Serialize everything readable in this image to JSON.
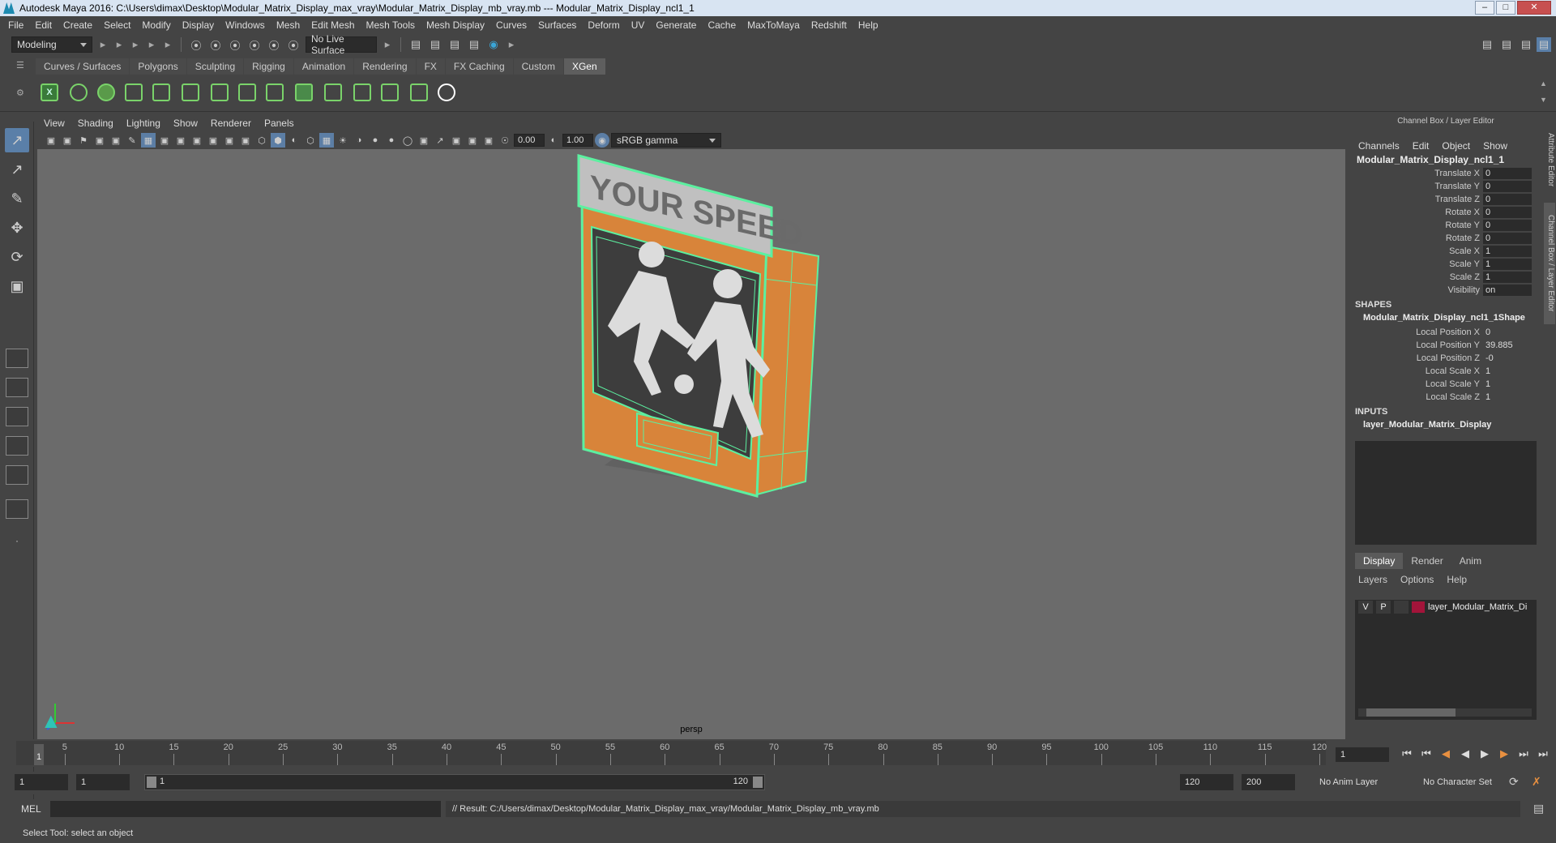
{
  "window": {
    "title": "Autodesk Maya 2016: C:\\Users\\dimax\\Desktop\\Modular_Matrix_Display_max_vray\\Modular_Matrix_Display_mb_vray.mb   ---   Modular_Matrix_Display_ncl1_1",
    "minimize": "–",
    "maximize": "□",
    "close": "✕"
  },
  "menubar": [
    "File",
    "Edit",
    "Create",
    "Select",
    "Modify",
    "Display",
    "Windows",
    "Mesh",
    "Edit Mesh",
    "Mesh Tools",
    "Mesh Display",
    "Curves",
    "Surfaces",
    "Deform",
    "UV",
    "Generate",
    "Cache",
    "MaxToMaya",
    "Redshift",
    "Help"
  ],
  "statusline": {
    "mode": "Modeling",
    "live_surface": "No Live Surface"
  },
  "shelf": {
    "tabs": [
      "Curves / Surfaces",
      "Polygons",
      "Sculpting",
      "Rigging",
      "Animation",
      "Rendering",
      "FX",
      "FX Caching",
      "Custom",
      "XGen"
    ],
    "active_tab": "XGen"
  },
  "viewport": {
    "menu": [
      "View",
      "Shading",
      "Lighting",
      "Show",
      "Renderer",
      "Panels"
    ],
    "exposure": "0.00",
    "gamma": "1.00",
    "color_space": "sRGB gamma",
    "camera_label": "persp",
    "sign_text": "YOUR SPEED"
  },
  "channel_box": {
    "title": "Channel Box / Layer Editor",
    "menu": [
      "Channels",
      "Edit",
      "Object",
      "Show"
    ],
    "object_name": "Modular_Matrix_Display_ncl1_1",
    "channels": [
      {
        "label": "Translate X",
        "value": "0"
      },
      {
        "label": "Translate Y",
        "value": "0"
      },
      {
        "label": "Translate Z",
        "value": "0"
      },
      {
        "label": "Rotate X",
        "value": "0"
      },
      {
        "label": "Rotate Y",
        "value": "0"
      },
      {
        "label": "Rotate Z",
        "value": "0"
      },
      {
        "label": "Scale X",
        "value": "1"
      },
      {
        "label": "Scale Y",
        "value": "1"
      },
      {
        "label": "Scale Z",
        "value": "1"
      },
      {
        "label": "Visibility",
        "value": "on"
      }
    ],
    "shapes_header": "SHAPES",
    "shape_name": "Modular_Matrix_Display_ncl1_1Shape",
    "shape_channels": [
      {
        "label": "Local Position X",
        "value": "0"
      },
      {
        "label": "Local Position Y",
        "value": "39.885"
      },
      {
        "label": "Local Position Z",
        "value": "-0"
      },
      {
        "label": "Local Scale X",
        "value": "1"
      },
      {
        "label": "Local Scale Y",
        "value": "1"
      },
      {
        "label": "Local Scale Z",
        "value": "1"
      }
    ],
    "inputs_header": "INPUTS",
    "input_name": "layer_Modular_Matrix_Display"
  },
  "layer_editor": {
    "tabs": [
      "Display",
      "Render",
      "Anim"
    ],
    "active_tab": "Display",
    "menu": [
      "Layers",
      "Options",
      "Help"
    ],
    "layer": {
      "v": "V",
      "p": "P",
      "name": "layer_Modular_Matrix_Di",
      "color": "#a3143a"
    }
  },
  "side_tabs": [
    "Attribute Editor",
    "Channel Box / Layer Editor"
  ],
  "timeline": {
    "ticks": [
      "5",
      "10",
      "15",
      "20",
      "25",
      "30",
      "35",
      "40",
      "45",
      "50",
      "55",
      "60",
      "65",
      "70",
      "75",
      "80",
      "85",
      "90",
      "95",
      "100",
      "105",
      "110",
      "115",
      "120"
    ],
    "current": "1",
    "frame_field": "1"
  },
  "range": {
    "start": "1",
    "start2": "1",
    "range_start": "1",
    "range_end": "120",
    "end": "120",
    "end2": "200",
    "anim_layer": "No Anim Layer",
    "char_set": "No Character Set"
  },
  "command": {
    "label": "MEL",
    "result": "// Result: C:/Users/dimax/Desktop/Modular_Matrix_Display_max_vray/Modular_Matrix_Display_mb_vray.mb"
  },
  "helpline": "Select Tool: select an object",
  "colors": {
    "wireframe": "#5cf0a0",
    "box": "#d8843a",
    "selected_tab": "#5a7fa8"
  }
}
